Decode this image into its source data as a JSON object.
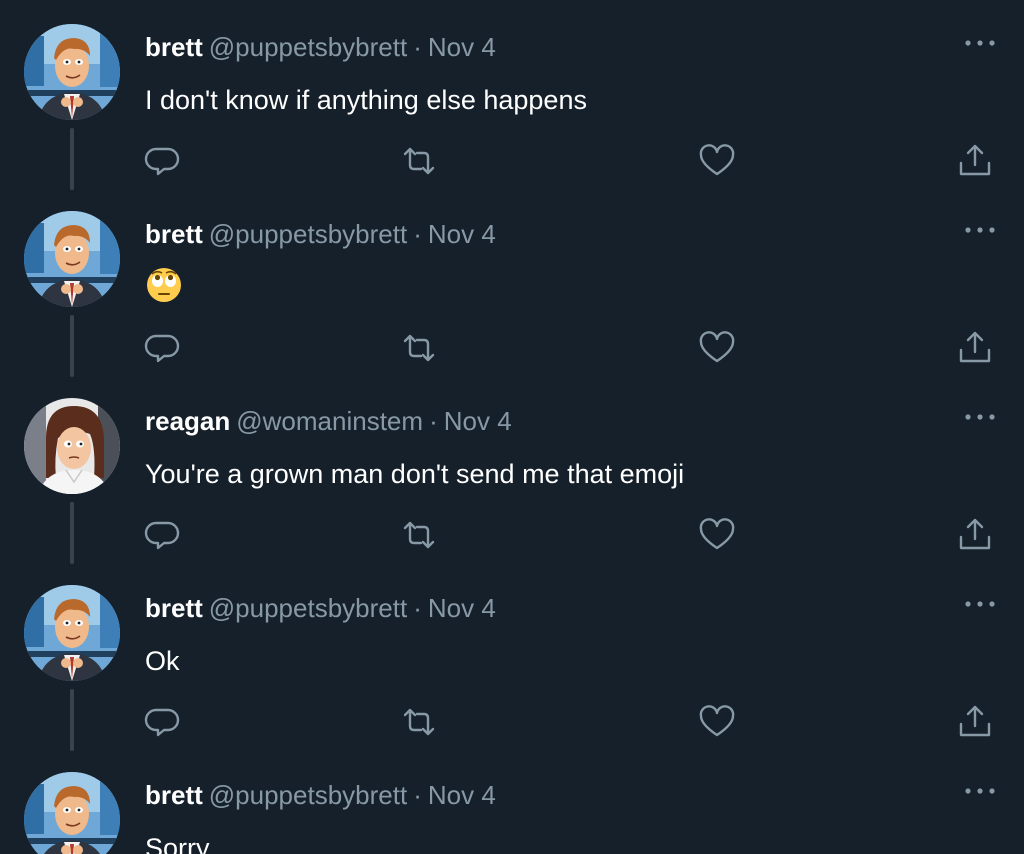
{
  "colors": {
    "background": "#15202b",
    "secondary_text": "#8899a6",
    "thread_line": "#38444d"
  },
  "tweets": [
    {
      "name": "brett",
      "handle": "@puppetsbybrett",
      "separator": "·",
      "time": "Nov 4",
      "text": "I don't know if anything else happens",
      "avatar": "brett-avatar"
    },
    {
      "name": "brett",
      "handle": "@puppetsbybrett",
      "separator": "·",
      "time": "Nov 4",
      "text": "",
      "emoji": "face-with-rolling-eyes",
      "avatar": "brett-avatar"
    },
    {
      "name": "reagan",
      "handle": "@womaninstem",
      "separator": "·",
      "time": "Nov 4",
      "text": "You're a grown man don't send me that emoji",
      "avatar": "reagan-avatar"
    },
    {
      "name": "brett",
      "handle": "@puppetsbybrett",
      "separator": "·",
      "time": "Nov 4",
      "text": "Ok",
      "avatar": "brett-avatar"
    },
    {
      "name": "brett",
      "handle": "@puppetsbybrett",
      "separator": "·",
      "time": "Nov 4",
      "text": "Sorry",
      "avatar": "brett-avatar"
    }
  ],
  "icons": {
    "reply": "reply-icon",
    "retweet": "retweet-icon",
    "like": "like-icon",
    "share": "share-icon",
    "more": "more-icon"
  }
}
